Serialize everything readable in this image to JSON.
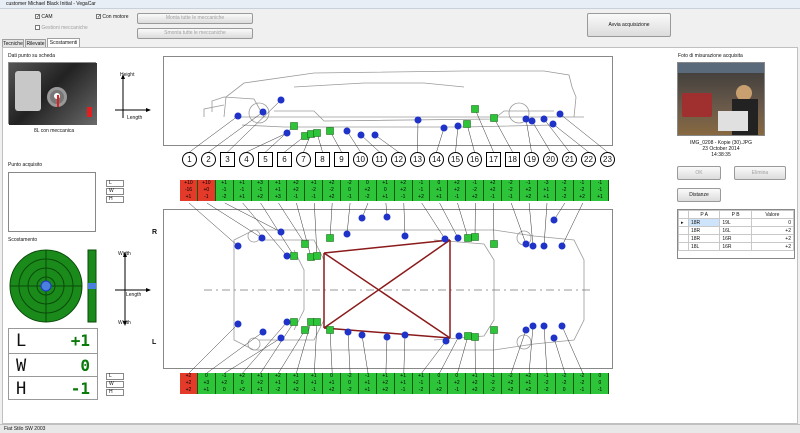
{
  "window": {
    "title": "customer Michael Black Initial - VegaCar"
  },
  "toolbar": {
    "cam_label": "CAM",
    "con_motore_label": "Con motore",
    "gestioni_label": "Gestioni meccaniche",
    "monta_label": "Monta tutte le meccaniche",
    "smonta_label": "Smonta tutte le meccaniche",
    "avvia_label": "Avvia acquisizione"
  },
  "tabs": [
    "Tecniche",
    "Rilevate",
    "Scostamenti"
  ],
  "left": {
    "dati_punto_title": "Dati punto su scheda",
    "point_caption": "8L con meccanica",
    "punto_acquisito_title": "Punto acquisito",
    "scostamento_title": "Scostamento",
    "lwh": [
      {
        "k": "L",
        "v": "+1"
      },
      {
        "k": "W",
        "v": "0"
      },
      {
        "k": "H",
        "v": "-1"
      }
    ]
  },
  "axes": {
    "height": "Height",
    "length_top": "Length",
    "width_top": "Width",
    "length_bot": "Length",
    "width_bot": "Width",
    "side_R": "R",
    "side_L": "L"
  },
  "points": [
    "1",
    "2",
    "3",
    "4",
    "5",
    "6",
    "7",
    "8",
    "9",
    "10",
    "11",
    "12",
    "13",
    "14",
    "15",
    "16",
    "17",
    "18",
    "19",
    "20",
    "21",
    "22",
    "23"
  ],
  "top_rows": {
    "labels": [
      "L",
      "W",
      "H"
    ],
    "L": [
      "+10",
      "+10",
      "+1",
      "+1",
      "+3",
      "+1",
      "+2",
      "+1",
      "+2",
      "-2",
      "0",
      "+1",
      "+2",
      "-1",
      "0",
      "+2",
      "-1",
      "+2",
      "-2",
      "-1",
      "-3",
      "-2",
      "-1",
      "-1"
    ],
    "W": [
      "-16",
      "+0",
      "-1",
      "-1",
      "-1",
      "+1",
      "+2",
      "-2",
      "-2",
      "0",
      "+2",
      "0",
      "+2",
      "-1",
      "+1",
      "+2",
      "-2",
      "+2",
      "-2",
      "+2",
      "+1",
      "-2",
      "-2",
      "-1"
    ],
    "H": [
      "+1",
      "-1",
      "-2",
      "+1",
      "+2",
      "+3",
      "-1",
      "-1",
      "+2",
      "-1",
      "-2",
      "+1",
      "-1",
      "+2",
      "+1",
      "-1",
      "+2",
      "-1",
      "-1",
      "+2",
      "+1",
      "-2",
      "+2",
      "+1"
    ],
    "red_cols": [
      0,
      1
    ]
  },
  "bot_rows": {
    "labels": [
      "L",
      "W",
      "H"
    ],
    "L": [
      "+2",
      "0",
      "-1",
      "+2",
      "+1",
      "+2",
      "+1",
      "+1",
      "0",
      "-2",
      "-1",
      "+1",
      "+1",
      "+1",
      "0",
      "0",
      "+1",
      "-1",
      "-2",
      "+2",
      "-1",
      "-2",
      "-2",
      "0"
    ],
    "W": [
      "+2",
      "+3",
      "+2",
      "0",
      "+2",
      "+1",
      "+2",
      "+1",
      "+1",
      "0",
      "+1",
      "+2",
      "+1",
      "-1",
      "-1",
      "+2",
      "+2",
      "-2",
      "+2",
      "+1",
      "-2",
      "-2",
      "-2",
      "0"
    ],
    "H": [
      "+2",
      "+1",
      "0",
      "+2",
      "+1",
      "-2",
      "+2",
      "-1",
      "+2",
      "-2",
      "+1",
      "+2",
      "-1",
      "-2",
      "+2",
      "-1",
      "+2",
      "-2",
      "+2",
      "+2",
      "-2",
      "0",
      "-1",
      "-1"
    ],
    "red_cols": [
      0
    ]
  },
  "photo": {
    "title": "Foto di misurazione acquisita",
    "file": "IMG_0208 - Kopie (30).JPG",
    "date": "23 October 2014",
    "time": "14:38:35",
    "ok_label": "OK",
    "elimina_label": "Elimina"
  },
  "distanze": {
    "button": "Distanze",
    "headers": [
      "P A",
      "P B",
      "Valore"
    ],
    "rows": [
      {
        "a": "18R",
        "b": "19L",
        "v": "0"
      },
      {
        "a": "18R",
        "b": "16L",
        "v": "+2"
      },
      {
        "a": "18R",
        "b": "16R",
        "v": "+2"
      },
      {
        "a": "18L",
        "b": "16R",
        "v": "+2"
      }
    ]
  },
  "status": {
    "model": "Fiat Stilo SW 2003"
  },
  "colors": {
    "ok": "#2ec43a",
    "bad": "#e43a2a",
    "point": "#1f33c8",
    "pointSel": "#2ec43a",
    "line": "#8b1a1a"
  }
}
